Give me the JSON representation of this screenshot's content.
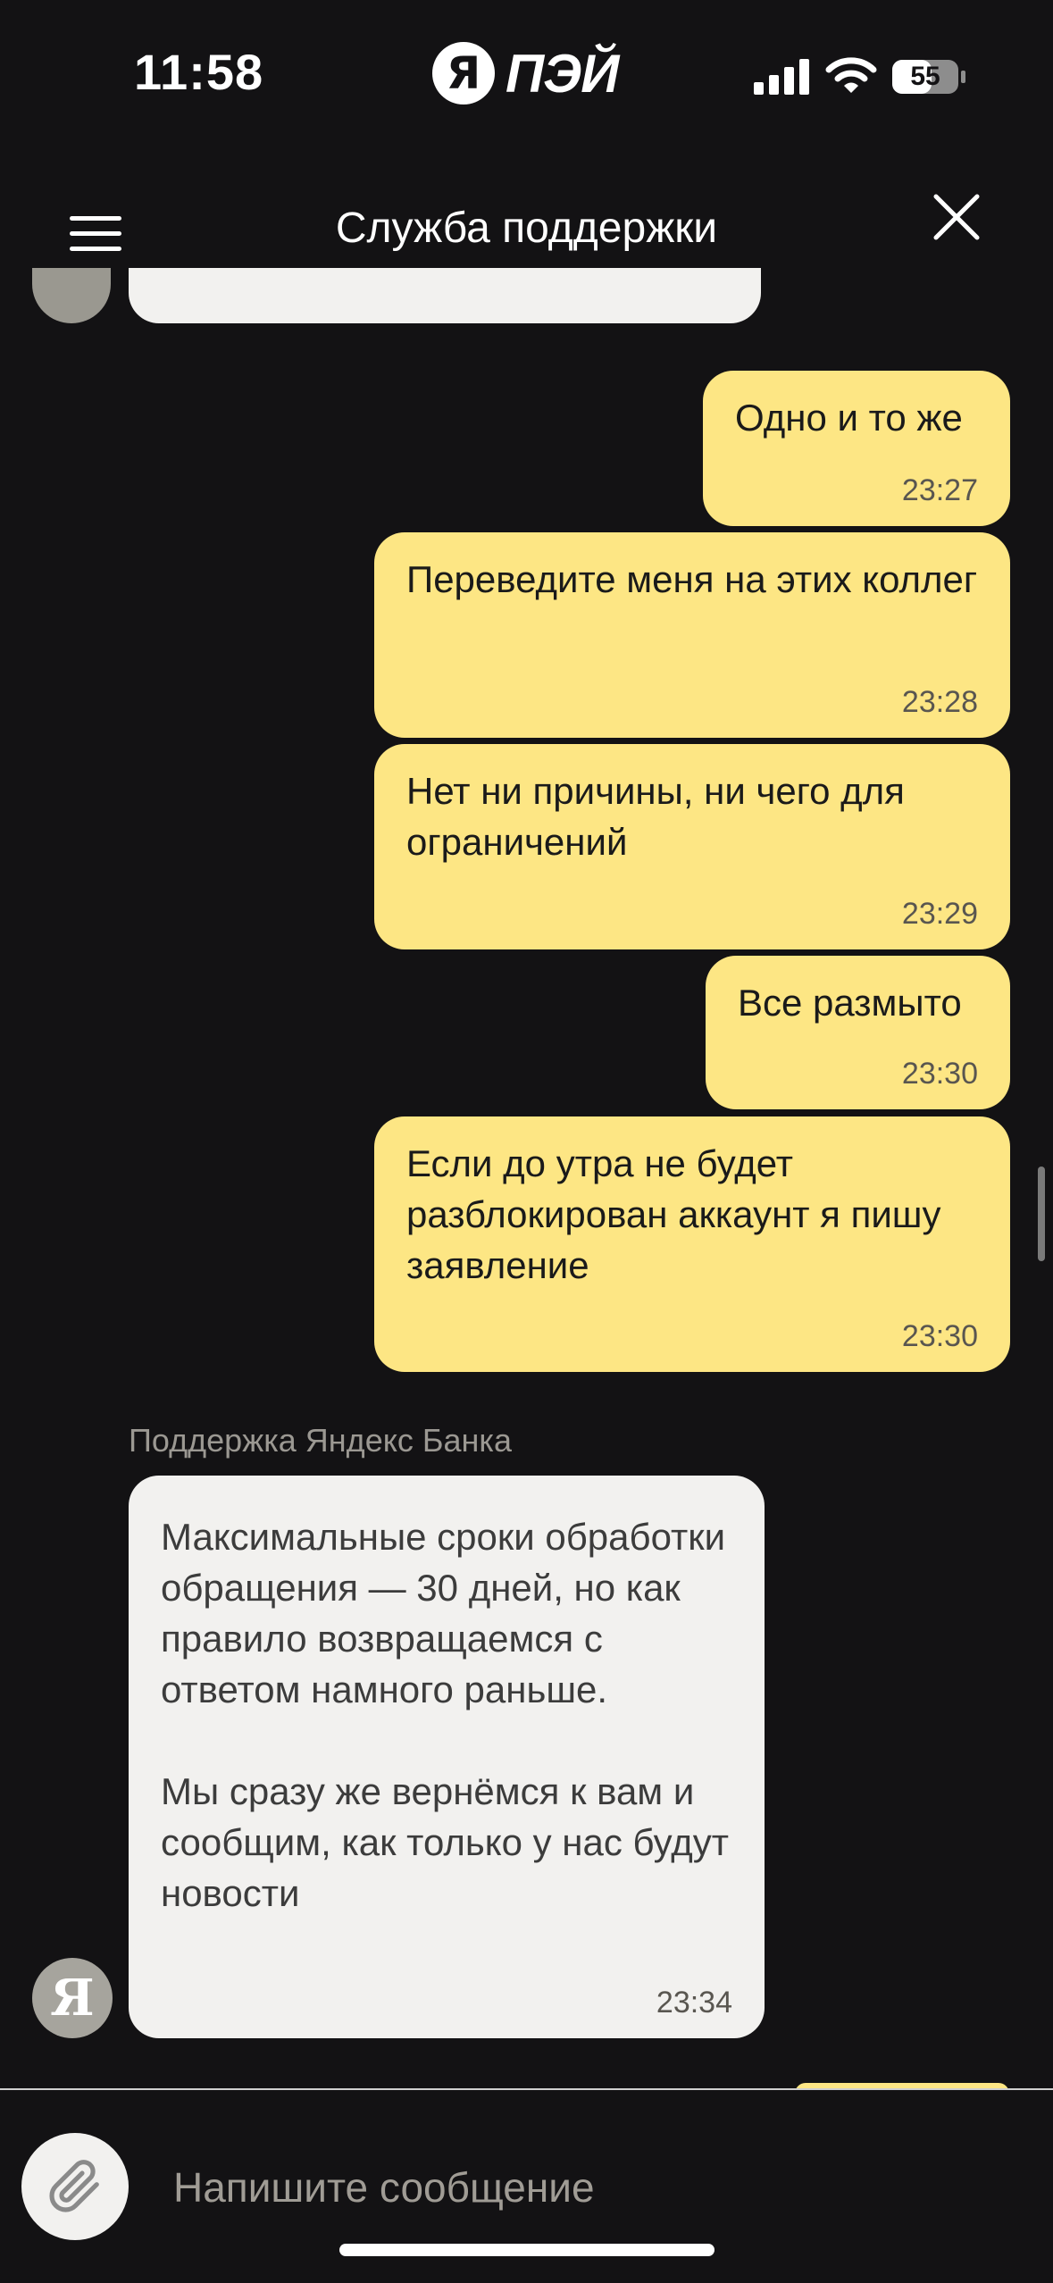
{
  "status_bar": {
    "time": "11:58",
    "battery": "55",
    "icons": [
      "signal-icon",
      "wifi-icon",
      "battery-icon"
    ]
  },
  "brand": {
    "logo_letter": "Я",
    "logo_text": "ПЭЙ"
  },
  "header": {
    "title": "Служба поддержки",
    "icons": [
      "menu-icon",
      "close-icon"
    ]
  },
  "messages": [
    {
      "direction": "outgoing",
      "text": "Одно и то же",
      "time": "23:27"
    },
    {
      "direction": "outgoing",
      "text": "Переведите меня на этих коллег",
      "time": "23:28"
    },
    {
      "direction": "outgoing",
      "text": "Нет ни причины, ни чего для ограничений",
      "time": "23:29"
    },
    {
      "direction": "outgoing",
      "text": "Все размыто",
      "time": "23:30"
    },
    {
      "direction": "outgoing",
      "text": "Если до утра не будет разблокирован аккаунт я пишу заявление",
      "time": "23:30"
    },
    {
      "direction": "incoming",
      "sender": "Поддержка Яндекс Банка",
      "avatar_letter": "Я",
      "text": "Максимальные сроки обработки обращения — 30 дней, но как правило возвращаемся с ответом намного раньше.\n\nМы сразу же вернёмся к вам и сообщим, как только у нас будут новости",
      "time": "23:34"
    }
  ],
  "composer": {
    "placeholder": "Напишите сообщение",
    "value": "",
    "icons": [
      "paperclip-icon"
    ]
  },
  "colors": {
    "background": "#131214",
    "outgoing_bubble": "#fde684",
    "incoming_bubble": "#f2f1ef"
  }
}
